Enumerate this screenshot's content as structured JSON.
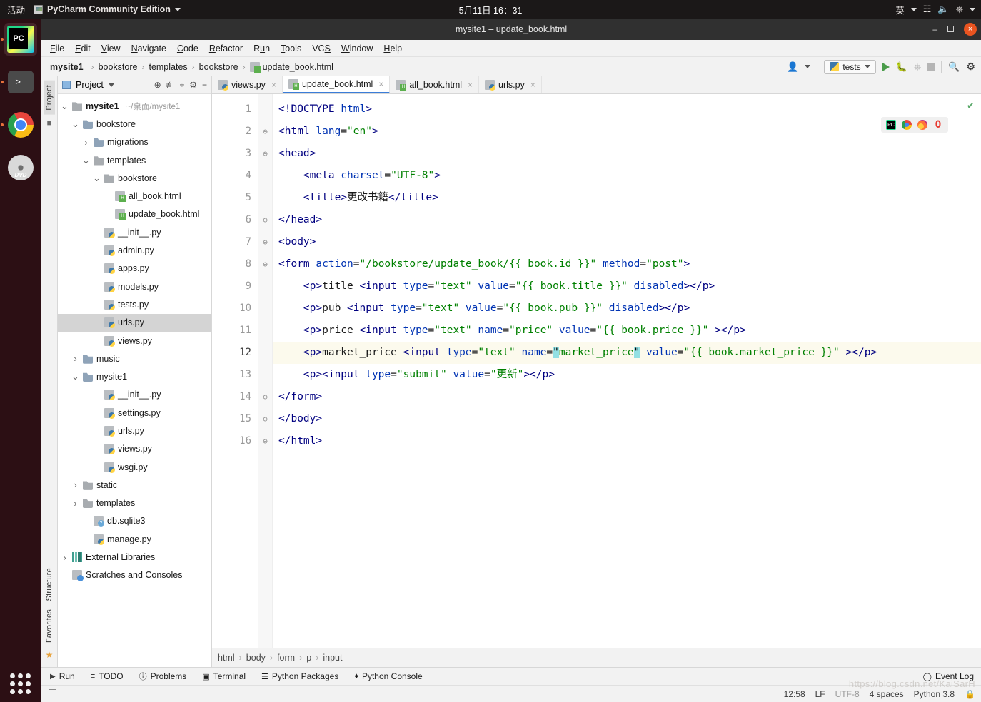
{
  "os_bar": {
    "activities": "活动",
    "app_name": "PyCharm Community Edition",
    "clock": "5月11日 16：31",
    "input_method": "英",
    "icons": [
      "network-icon",
      "volume-icon",
      "power-icon",
      "caret-down-icon"
    ]
  },
  "dock": {
    "items": [
      {
        "name": "pycharm",
        "label": "PC",
        "running": true,
        "active": true
      },
      {
        "name": "terminal",
        "label": ">_",
        "running": true,
        "active": false
      },
      {
        "name": "chrome",
        "label": "",
        "running": true,
        "active": false
      },
      {
        "name": "dvd",
        "label": "DVD",
        "running": false,
        "active": false
      }
    ],
    "show_apps": "show-applications"
  },
  "window": {
    "title": "mysite1 – update_book.html",
    "minimize": "–",
    "maximize": "□",
    "close": "×"
  },
  "menubar": [
    {
      "pre": "",
      "mn": "F",
      "post": "ile"
    },
    {
      "pre": "",
      "mn": "E",
      "post": "dit"
    },
    {
      "pre": "",
      "mn": "V",
      "post": "iew"
    },
    {
      "pre": "",
      "mn": "N",
      "post": "avigate"
    },
    {
      "pre": "",
      "mn": "C",
      "post": "ode"
    },
    {
      "pre": "",
      "mn": "R",
      "post": "efactor"
    },
    {
      "pre": "R",
      "mn": "u",
      "post": "n"
    },
    {
      "pre": "",
      "mn": "T",
      "post": "ools"
    },
    {
      "pre": "VC",
      "mn": "S",
      "post": ""
    },
    {
      "pre": "",
      "mn": "W",
      "post": "indow"
    },
    {
      "pre": "",
      "mn": "H",
      "post": "elp"
    }
  ],
  "navbar": {
    "crumbs": [
      "mysite1",
      "bookstore",
      "templates",
      "bookstore",
      "update_book.html"
    ],
    "separator": "›",
    "run_config": "tests",
    "buttons": [
      "person-icon",
      "run-icon",
      "debug-icon",
      "coverage-icon",
      "stop-icon",
      "search-everywhere-icon",
      "settings-icon"
    ]
  },
  "left_strip": {
    "top_tabs": [
      "Project"
    ],
    "bottom_tabs": [
      "Structure",
      "Favorites"
    ]
  },
  "project_panel": {
    "title": "Project",
    "toolbar_icons": [
      "locate-icon",
      "expand-all-icon",
      "collapse-all-icon",
      "settings-icon",
      "hide-icon"
    ],
    "tree": [
      {
        "depth": 0,
        "arrow": "v",
        "icon": "folder",
        "label": "mysite1",
        "bold": true,
        "path": "~/桌面/mysite1",
        "selected": false
      },
      {
        "depth": 1,
        "arrow": "v",
        "icon": "module",
        "label": "bookstore",
        "bold": false,
        "path": "",
        "selected": false
      },
      {
        "depth": 2,
        "arrow": ">",
        "icon": "module",
        "label": "migrations",
        "bold": false,
        "path": "",
        "selected": false
      },
      {
        "depth": 2,
        "arrow": "v",
        "icon": "folder",
        "label": "templates",
        "bold": false,
        "path": "",
        "selected": false
      },
      {
        "depth": 3,
        "arrow": "v",
        "icon": "folder",
        "label": "bookstore",
        "bold": false,
        "path": "",
        "selected": false
      },
      {
        "depth": 4,
        "arrow": "",
        "icon": "html",
        "label": "all_book.html",
        "bold": false,
        "path": "",
        "selected": false
      },
      {
        "depth": 4,
        "arrow": "",
        "icon": "html",
        "label": "update_book.html",
        "bold": false,
        "path": "",
        "selected": false
      },
      {
        "depth": 3,
        "arrow": "",
        "icon": "py",
        "label": "__init__.py",
        "bold": false,
        "path": "",
        "selected": false
      },
      {
        "depth": 3,
        "arrow": "",
        "icon": "py",
        "label": "admin.py",
        "bold": false,
        "path": "",
        "selected": false
      },
      {
        "depth": 3,
        "arrow": "",
        "icon": "py",
        "label": "apps.py",
        "bold": false,
        "path": "",
        "selected": false
      },
      {
        "depth": 3,
        "arrow": "",
        "icon": "py",
        "label": "models.py",
        "bold": false,
        "path": "",
        "selected": false
      },
      {
        "depth": 3,
        "arrow": "",
        "icon": "py",
        "label": "tests.py",
        "bold": false,
        "path": "",
        "selected": false
      },
      {
        "depth": 3,
        "arrow": "",
        "icon": "py",
        "label": "urls.py",
        "bold": false,
        "path": "",
        "selected": true
      },
      {
        "depth": 3,
        "arrow": "",
        "icon": "py",
        "label": "views.py",
        "bold": false,
        "path": "",
        "selected": false
      },
      {
        "depth": 1,
        "arrow": ">",
        "icon": "module",
        "label": "music",
        "bold": false,
        "path": "",
        "selected": false
      },
      {
        "depth": 1,
        "arrow": "v",
        "icon": "module",
        "label": "mysite1",
        "bold": false,
        "path": "",
        "selected": false
      },
      {
        "depth": 3,
        "arrow": "",
        "icon": "py",
        "label": "__init__.py",
        "bold": false,
        "path": "",
        "selected": false
      },
      {
        "depth": 3,
        "arrow": "",
        "icon": "py",
        "label": "settings.py",
        "bold": false,
        "path": "",
        "selected": false
      },
      {
        "depth": 3,
        "arrow": "",
        "icon": "py",
        "label": "urls.py",
        "bold": false,
        "path": "",
        "selected": false
      },
      {
        "depth": 3,
        "arrow": "",
        "icon": "py",
        "label": "views.py",
        "bold": false,
        "path": "",
        "selected": false
      },
      {
        "depth": 3,
        "arrow": "",
        "icon": "py",
        "label": "wsgi.py",
        "bold": false,
        "path": "",
        "selected": false
      },
      {
        "depth": 1,
        "arrow": ">",
        "icon": "folder",
        "label": "static",
        "bold": false,
        "path": "",
        "selected": false
      },
      {
        "depth": 1,
        "arrow": ">",
        "icon": "folder",
        "label": "templates",
        "bold": false,
        "path": "",
        "selected": false
      },
      {
        "depth": 2,
        "arrow": "",
        "icon": "db",
        "label": "db.sqlite3",
        "bold": false,
        "path": "",
        "selected": false
      },
      {
        "depth": 2,
        "arrow": "",
        "icon": "py",
        "label": "manage.py",
        "bold": false,
        "path": "",
        "selected": false
      },
      {
        "depth": 0,
        "arrow": ">",
        "icon": "lib",
        "label": "External Libraries",
        "bold": false,
        "path": "",
        "selected": false
      },
      {
        "depth": 0,
        "arrow": "",
        "icon": "scratch",
        "label": "Scratches and Consoles",
        "bold": false,
        "path": "",
        "selected": false
      }
    ]
  },
  "editor_tabs": [
    {
      "label": "views.py",
      "icon": "py",
      "active": false
    },
    {
      "label": "update_book.html",
      "icon": "html",
      "active": true
    },
    {
      "label": "all_book.html",
      "icon": "html",
      "active": false
    },
    {
      "label": "urls.py",
      "icon": "py",
      "active": false
    }
  ],
  "browser_bar": [
    "pycharm-preview-icon",
    "chrome-icon",
    "firefox-icon",
    "opera-icon"
  ],
  "inspection_status": "✔",
  "editor": {
    "language": "HTML",
    "current_line": 12,
    "lines": [
      {
        "n": 1,
        "fold": "",
        "tokens": [
          {
            "t": "<!DOCTYPE ",
            "c": "tag"
          },
          {
            "t": "html",
            "c": "attr"
          },
          {
            "t": ">",
            "c": "tag"
          }
        ]
      },
      {
        "n": 2,
        "fold": "-",
        "tokens": [
          {
            "t": "<html ",
            "c": "tag"
          },
          {
            "t": "lang",
            "c": "attr"
          },
          {
            "t": "=",
            "c": "op"
          },
          {
            "t": "\"en\"",
            "c": "str"
          },
          {
            "t": ">",
            "c": "tag"
          }
        ]
      },
      {
        "n": 3,
        "fold": "-",
        "tokens": [
          {
            "t": "<head>",
            "c": "tag"
          }
        ]
      },
      {
        "n": 4,
        "fold": "",
        "tokens": [
          {
            "t": "    <meta ",
            "c": "tag"
          },
          {
            "t": "charset",
            "c": "attr"
          },
          {
            "t": "=",
            "c": "op"
          },
          {
            "t": "\"UTF-8\"",
            "c": "str"
          },
          {
            "t": ">",
            "c": "tag"
          }
        ]
      },
      {
        "n": 5,
        "fold": "",
        "tokens": [
          {
            "t": "    <title>",
            "c": "tag"
          },
          {
            "t": "更改书籍",
            "c": "plain"
          },
          {
            "t": "</title>",
            "c": "tag"
          }
        ]
      },
      {
        "n": 6,
        "fold": "-",
        "tokens": [
          {
            "t": "</head>",
            "c": "tag"
          }
        ]
      },
      {
        "n": 7,
        "fold": "-",
        "tokens": [
          {
            "t": "<body>",
            "c": "tag"
          }
        ]
      },
      {
        "n": 8,
        "fold": "-",
        "tokens": [
          {
            "t": "<form ",
            "c": "tag"
          },
          {
            "t": "action",
            "c": "attr"
          },
          {
            "t": "=",
            "c": "op"
          },
          {
            "t": "\"/bookstore/update_book/{{ book.id }}\"",
            "c": "str"
          },
          {
            "t": " ",
            "c": "plain"
          },
          {
            "t": "method",
            "c": "attr"
          },
          {
            "t": "=",
            "c": "op"
          },
          {
            "t": "\"post\"",
            "c": "str"
          },
          {
            "t": ">",
            "c": "tag"
          }
        ]
      },
      {
        "n": 9,
        "fold": "",
        "tokens": [
          {
            "t": "    <p>",
            "c": "tag"
          },
          {
            "t": "title ",
            "c": "plain"
          },
          {
            "t": "<input ",
            "c": "tag"
          },
          {
            "t": "type",
            "c": "attr"
          },
          {
            "t": "=",
            "c": "op"
          },
          {
            "t": "\"text\"",
            "c": "str"
          },
          {
            "t": " ",
            "c": "plain"
          },
          {
            "t": "value",
            "c": "attr"
          },
          {
            "t": "=",
            "c": "op"
          },
          {
            "t": "\"{{ book.title }}\"",
            "c": "str"
          },
          {
            "t": " ",
            "c": "plain"
          },
          {
            "t": "disabled",
            "c": "attr"
          },
          {
            "t": ">",
            "c": "tag"
          },
          {
            "t": "</p>",
            "c": "tag"
          }
        ]
      },
      {
        "n": 10,
        "fold": "",
        "tokens": [
          {
            "t": "    <p>",
            "c": "tag"
          },
          {
            "t": "pub ",
            "c": "plain"
          },
          {
            "t": "<input ",
            "c": "tag"
          },
          {
            "t": "type",
            "c": "attr"
          },
          {
            "t": "=",
            "c": "op"
          },
          {
            "t": "\"text\"",
            "c": "str"
          },
          {
            "t": " ",
            "c": "plain"
          },
          {
            "t": "value",
            "c": "attr"
          },
          {
            "t": "=",
            "c": "op"
          },
          {
            "t": "\"{{ book.pub }}\"",
            "c": "str"
          },
          {
            "t": " ",
            "c": "plain"
          },
          {
            "t": "disabled",
            "c": "attr"
          },
          {
            "t": ">",
            "c": "tag"
          },
          {
            "t": "</p>",
            "c": "tag"
          }
        ]
      },
      {
        "n": 11,
        "fold": "",
        "tokens": [
          {
            "t": "    <p>",
            "c": "tag"
          },
          {
            "t": "price ",
            "c": "plain"
          },
          {
            "t": "<input ",
            "c": "tag"
          },
          {
            "t": "type",
            "c": "attr"
          },
          {
            "t": "=",
            "c": "op"
          },
          {
            "t": "\"text\"",
            "c": "str"
          },
          {
            "t": " ",
            "c": "plain"
          },
          {
            "t": "name",
            "c": "attr"
          },
          {
            "t": "=",
            "c": "op"
          },
          {
            "t": "\"price\"",
            "c": "str"
          },
          {
            "t": " ",
            "c": "plain"
          },
          {
            "t": "value",
            "c": "attr"
          },
          {
            "t": "=",
            "c": "op"
          },
          {
            "t": "\"{{ book.price }}\"",
            "c": "str"
          },
          {
            "t": " >",
            "c": "tag"
          },
          {
            "t": "</p>",
            "c": "tag"
          }
        ]
      },
      {
        "n": 12,
        "fold": "",
        "highlight": true,
        "tokens": [
          {
            "t": "    <p>",
            "c": "tag"
          },
          {
            "t": "market_price ",
            "c": "plain"
          },
          {
            "t": "<input ",
            "c": "tag"
          },
          {
            "t": "type",
            "c": "attr"
          },
          {
            "t": "=",
            "c": "op"
          },
          {
            "t": "\"text\"",
            "c": "str"
          },
          {
            "t": " ",
            "c": "plain"
          },
          {
            "t": "name",
            "c": "attr"
          },
          {
            "t": "=",
            "c": "op"
          },
          {
            "t": "\"",
            "c": "matchq"
          },
          {
            "t": "market_price",
            "c": "str"
          },
          {
            "t": "\"",
            "c": "matchq"
          },
          {
            "t": " ",
            "c": "plain"
          },
          {
            "t": "value",
            "c": "attr"
          },
          {
            "t": "=",
            "c": "op"
          },
          {
            "t": "\"{{ book.market_price }}\"",
            "c": "str"
          },
          {
            "t": " >",
            "c": "tag"
          },
          {
            "t": "</p>",
            "c": "tag"
          }
        ]
      },
      {
        "n": 13,
        "fold": "",
        "tokens": [
          {
            "t": "    <p>",
            "c": "tag"
          },
          {
            "t": "<input ",
            "c": "tag"
          },
          {
            "t": "type",
            "c": "attr"
          },
          {
            "t": "=",
            "c": "op"
          },
          {
            "t": "\"submit\"",
            "c": "str"
          },
          {
            "t": " ",
            "c": "plain"
          },
          {
            "t": "value",
            "c": "attr"
          },
          {
            "t": "=",
            "c": "op"
          },
          {
            "t": "\"更新\"",
            "c": "str"
          },
          {
            "t": ">",
            "c": "tag"
          },
          {
            "t": "</p>",
            "c": "tag"
          }
        ]
      },
      {
        "n": 14,
        "fold": "-",
        "tokens": [
          {
            "t": "</form>",
            "c": "tag"
          }
        ]
      },
      {
        "n": 15,
        "fold": "-",
        "tokens": [
          {
            "t": "</body>",
            "c": "tag"
          }
        ]
      },
      {
        "n": 16,
        "fold": "-",
        "tokens": [
          {
            "t": "</html>",
            "c": "tag"
          }
        ]
      }
    ]
  },
  "editor_breadcrumb": {
    "items": [
      "html",
      "body",
      "form",
      "p",
      "input"
    ],
    "separator": "›"
  },
  "bottom_toolwindows": [
    {
      "label": "Run",
      "icon": "run-icon"
    },
    {
      "label": "TODO",
      "icon": "todo-icon"
    },
    {
      "label": "Problems",
      "icon": "problems-icon"
    },
    {
      "label": "Terminal",
      "icon": "terminal-icon"
    },
    {
      "label": "Python Packages",
      "icon": "packages-icon"
    },
    {
      "label": "Python Console",
      "icon": "python-console-icon"
    }
  ],
  "event_log": "Event Log",
  "statusbar": {
    "caret": "12:58",
    "line_separator": "LF",
    "encoding": "UTF-8",
    "indent": "4 spaces",
    "interpreter": "Python 3.8",
    "lock": "lock-icon"
  },
  "watermark": "https://blog.csdn.net/KaiSarH",
  "colors": {
    "accent_blue": "#3b7dd8",
    "string_green": "#008000",
    "tag_navy": "#000080",
    "attr_blue": "#0033b3",
    "match_cyan": "#93e0e3",
    "line_highlight": "#fcfaed",
    "selection_gray": "#d4d4d4",
    "ubuntu_orange": "#e95420"
  }
}
